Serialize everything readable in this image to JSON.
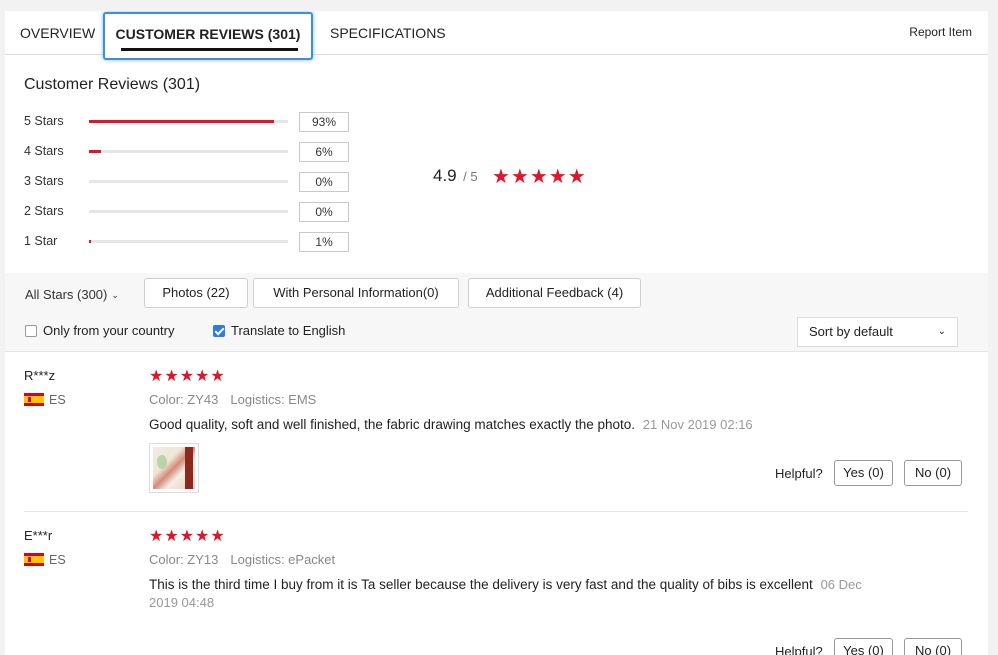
{
  "tabs": [
    {
      "label": "OVERVIEW"
    },
    {
      "label": "CUSTOMER REVIEWS (301)"
    },
    {
      "label": "SPECIFICATIONS"
    }
  ],
  "report_label": "Report Item",
  "summary": {
    "title": "Customer Reviews (301)",
    "rows": [
      {
        "label": "5 Stars",
        "pct": "93%",
        "fill": 0.93
      },
      {
        "label": "4 Stars",
        "pct": "6%",
        "fill": 0.06
      },
      {
        "label": "3 Stars",
        "pct": "0%",
        "fill": 0.0
      },
      {
        "label": "2 Stars",
        "pct": "0%",
        "fill": 0.0
      },
      {
        "label": "1 Star",
        "pct": "1%",
        "fill": 0.01
      }
    ],
    "average": "4.9",
    "out_of": "/ 5",
    "stars": "★★★★★"
  },
  "filters": {
    "all_stars": "All Stars (300)",
    "buttons": [
      "Photos (22)",
      "With Personal Information(0)",
      "Additional Feedback (4)"
    ],
    "only_country": "Only from your country",
    "only_country_checked": false,
    "translate": "Translate to English",
    "translate_checked": true,
    "sort": "Sort by default"
  },
  "reviews": [
    {
      "name": "R***z",
      "country": "ES",
      "stars": "★★★★★",
      "color": "Color: ZY43",
      "logistics": "Logistics: EMS",
      "text": "Good quality, soft and well finished, the fabric drawing matches exactly the photo.",
      "date": "21 Nov 2019 02:16",
      "helpful": "Helpful?",
      "yes": "Yes (0)",
      "no": "No (0)"
    },
    {
      "name": "E***r",
      "country": "ES",
      "stars": "★★★★★",
      "color": "Color: ZY13",
      "logistics": "Logistics: ePacket",
      "text": "This is the third time I buy from it is Ta seller because the delivery is very fast and the quality of bibs is excellent",
      "date": "06 Dec 2019 04:48",
      "helpful": "Helpful?",
      "yes": "Yes (0)",
      "no": "No (0)"
    }
  ],
  "colors": {
    "accent": "#e0142a",
    "tab_focus": "#3d8ee0",
    "checkbox": "#2a7fdc"
  }
}
